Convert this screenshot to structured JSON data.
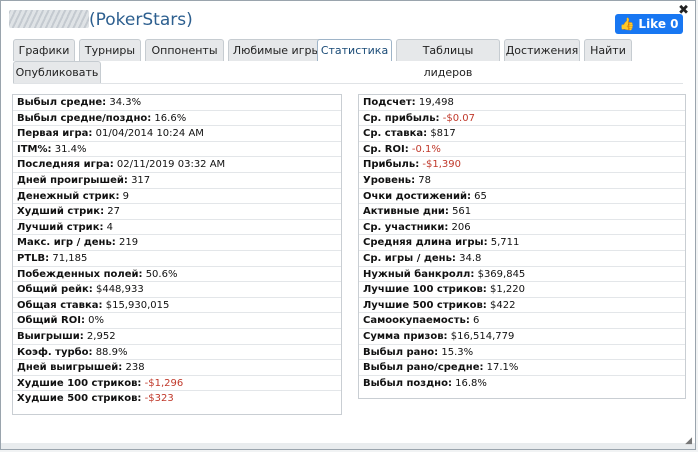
{
  "header": {
    "player_name": "",
    "room_label": "(PokerStars)",
    "like_label": "Like 0",
    "close_glyph": "✖"
  },
  "tabs": [
    {
      "label": "Графики"
    },
    {
      "label": "Турниры"
    },
    {
      "label": "Оппоненты"
    },
    {
      "label": "Любимые игры"
    },
    {
      "label": "Статистика"
    },
    {
      "label": "Таблицы лидеров"
    },
    {
      "label": "Достижения"
    },
    {
      "label": "Найти"
    },
    {
      "label": "Опубликовать"
    }
  ],
  "active_tab": "Статистика",
  "left_stats": [
    {
      "label": "Выбыл средне:",
      "value": "34.3%"
    },
    {
      "label": "Выбыл средне/поздно:",
      "value": "16.6%"
    },
    {
      "label": "Первая игра:",
      "value": "01/04/2014 10:24 AM"
    },
    {
      "label": "ITM%:",
      "value": "31.4%"
    },
    {
      "label": "Последняя игра:",
      "value": "02/11/2019 03:32 AM"
    },
    {
      "label": "Дней проигрышей:",
      "value": "317"
    },
    {
      "label": "Денежный стрик:",
      "value": "9"
    },
    {
      "label": "Худший стрик:",
      "value": "27"
    },
    {
      "label": "Лучший стрик:",
      "value": "4"
    },
    {
      "label": "Макс. игр / день:",
      "value": "219"
    },
    {
      "label": "PTLB:",
      "value": "71,185"
    },
    {
      "label": "Побежденных полей:",
      "value": "50.6%"
    },
    {
      "label": "Общий рейк:",
      "value": "$448,933"
    },
    {
      "label": "Общая ставка:",
      "value": "$15,930,015"
    },
    {
      "label": "Общий ROI:",
      "value": "0%"
    },
    {
      "label": "Выигрыши:",
      "value": "2,952"
    },
    {
      "label": "Коэф. турбо:",
      "value": "88.9%"
    },
    {
      "label": "Дней выигрышей:",
      "value": "238"
    },
    {
      "label": "Худшие 100 стриков:",
      "value": "-$1,296",
      "negative": true
    },
    {
      "label": "Худшие 500 стриков:",
      "value": "-$323",
      "negative": true
    }
  ],
  "right_stats": [
    {
      "label": "Подсчет:",
      "value": "19,498"
    },
    {
      "label": "Ср. прибыль:",
      "value": "-$0.07",
      "negative": true
    },
    {
      "label": "Ср. ставка:",
      "value": "$817"
    },
    {
      "label": "Ср. ROI:",
      "value": "-0.1%",
      "negative": true
    },
    {
      "label": "Прибыль:",
      "value": "-$1,390",
      "negative": true
    },
    {
      "label": "Уровень:",
      "value": "78"
    },
    {
      "label": "Очки достижений:",
      "value": "65"
    },
    {
      "label": "Активные дни:",
      "value": "561"
    },
    {
      "label": "Ср. участники:",
      "value": "206"
    },
    {
      "label": "Средняя длина игры:",
      "value": "5,711"
    },
    {
      "label": "Ср. игры / день:",
      "value": "34.8"
    },
    {
      "label": "Нужный банкролл:",
      "value": "$369,845"
    },
    {
      "label": "Лучшие 100 стриков:",
      "value": "$1,220"
    },
    {
      "label": "Лучшие 500 стриков:",
      "value": "$422"
    },
    {
      "label": "Самоокупаемость:",
      "value": "6"
    },
    {
      "label": "Сумма призов:",
      "value": "$16,514,779"
    },
    {
      "label": "Выбыл рано:",
      "value": "15.3%"
    },
    {
      "label": "Выбыл рано/средне:",
      "value": "17.1%"
    },
    {
      "label": "Выбыл поздно:",
      "value": "16.8%"
    }
  ],
  "colors": {
    "accent": "#2d5f8f",
    "negative": "#c0392b",
    "facebook": "#1877f2"
  },
  "icons": {
    "like": "thumbs-up-icon",
    "close": "close-icon",
    "resize": "resize-grip-icon"
  }
}
